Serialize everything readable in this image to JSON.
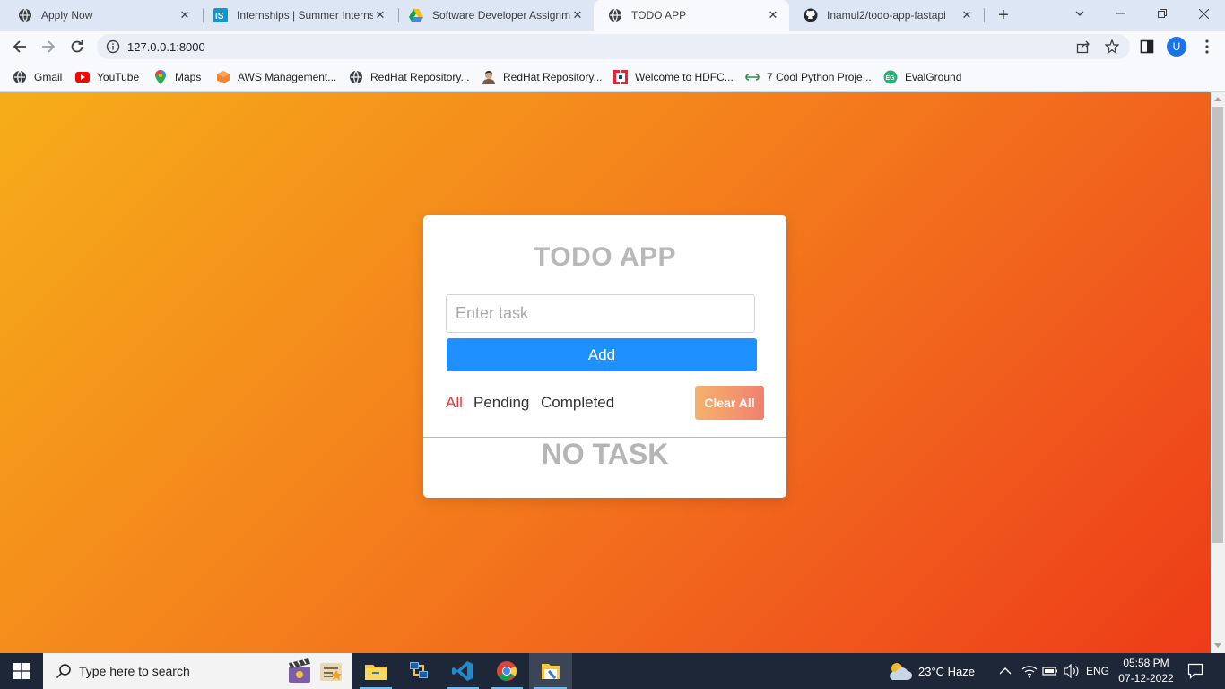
{
  "browser": {
    "tabs": [
      {
        "title": "Apply Now",
        "icon": "globe-icon",
        "active": false
      },
      {
        "title": "Internships | Summer Interns",
        "icon": "internshala-icon",
        "active": false
      },
      {
        "title": "Software Developer Assignm",
        "icon": "google-drive-icon",
        "active": false
      },
      {
        "title": "TODO APP",
        "icon": "globe-icon",
        "active": true
      },
      {
        "title": "Inamul2/todo-app-fastapi",
        "icon": "github-icon",
        "active": false
      }
    ],
    "url": "127.0.0.1:8000",
    "profile_initial": "U",
    "bookmarks": [
      {
        "label": "Gmail",
        "icon": "globe-icon"
      },
      {
        "label": "YouTube",
        "icon": "youtube-icon"
      },
      {
        "label": "Maps",
        "icon": "maps-icon"
      },
      {
        "label": "AWS Management...",
        "icon": "aws-icon"
      },
      {
        "label": "RedHat Repository...",
        "icon": "globe-icon"
      },
      {
        "label": "RedHat Repository...",
        "icon": "avatar-icon"
      },
      {
        "label": "Welcome to HDFC...",
        "icon": "hdfc-icon"
      },
      {
        "label": "7 Cool Python Proje...",
        "icon": "geeksforgeeks-icon"
      },
      {
        "label": "EvalGround",
        "icon": "evalground-icon"
      }
    ]
  },
  "app": {
    "title": "TODO APP",
    "input_placeholder": "Enter task",
    "add_label": "Add",
    "filters": [
      "All",
      "Pending",
      "Completed"
    ],
    "active_filter": "All",
    "clear_label": "Clear All",
    "empty_message": "NO TASK",
    "colors": {
      "accent_blue": "#1e90ff",
      "active_filter": "#e53935",
      "bg_start": "#f6ad19",
      "bg_end": "#ee3b17"
    }
  },
  "taskbar": {
    "search_placeholder": "Type here to search",
    "weather": "23°C  Haze",
    "language": "ENG",
    "time": "05:58 PM",
    "date": "07-12-2022"
  }
}
